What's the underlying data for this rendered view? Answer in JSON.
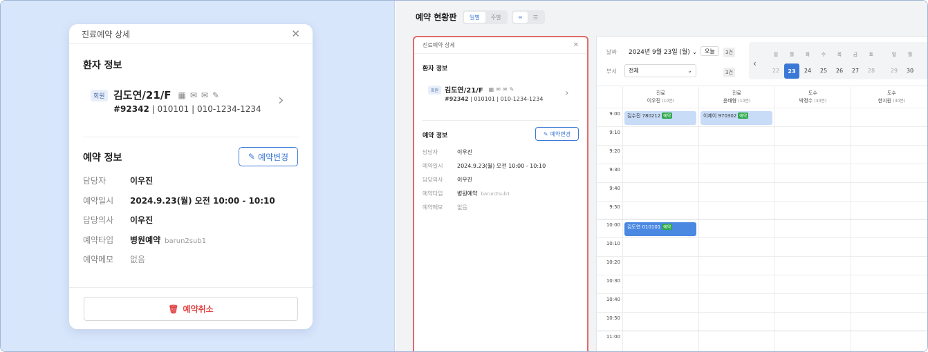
{
  "left_card": {
    "title": "진료예약 상세",
    "patient_section": "환자 정보",
    "badge": "회원",
    "patient_name": "김도연/21/F",
    "patient_id": "#92342",
    "patient_detail": "| 010101 | 010-1234-1234",
    "reservation_section": "예약 정보",
    "change_button": "예약변경",
    "rows": [
      {
        "k": "담당자",
        "v": "이우진"
      },
      {
        "k": "예약일시",
        "v": "2024.9.23(월)  오전 10:00 - 10:10"
      },
      {
        "k": "담당의사",
        "v": "이우진"
      },
      {
        "k": "예약타입",
        "v": "병원예약",
        "sub": "barun2sub1"
      },
      {
        "k": "예약메모",
        "v": "없음"
      }
    ],
    "cancel_button": "예약취소"
  },
  "right": {
    "title": "예약 현황판",
    "seg1": [
      "일별",
      "주별"
    ],
    "popup": {
      "title": "진료예약 상세",
      "patient_section": "환자 정보",
      "badge": "회원",
      "patient_name": "김도연/21/F",
      "patient_id": "#92342",
      "patient_detail": "| 010101 | 010-1234-1234",
      "reservation_section": "예약 정보",
      "change_button": "예약변경",
      "rows": [
        {
          "k": "담당자",
          "v": "이우진"
        },
        {
          "k": "예약일시",
          "v": "2024.9.23(월)  오전 10:00 - 10:10"
        },
        {
          "k": "담당의사",
          "v": "이우진"
        },
        {
          "k": "예약타입",
          "v": "병원예약",
          "sub": "barun2sub1"
        },
        {
          "k": "예약메모",
          "v": "없음"
        }
      ]
    },
    "filters": {
      "date_label": "날짜",
      "date_value": "2024년 9월 23일 (월)",
      "today": "오늘",
      "count1": "3건",
      "dept_label": "부서",
      "dept_value": "전체",
      "count2": "3건"
    },
    "mini_cal": {
      "weekdays": [
        "일",
        "월",
        "화",
        "수",
        "목",
        "금",
        "토",
        "일",
        "월"
      ],
      "days": [
        "22",
        "23",
        "24",
        "25",
        "26",
        "27",
        "28",
        "29",
        "30"
      ]
    },
    "columns": [
      {
        "dept": "진료",
        "name": "이우진",
        "dur": "(10분)"
      },
      {
        "dept": "진료",
        "name": "윤태형",
        "dur": "(10분)"
      },
      {
        "dept": "도수",
        "name": "박정수",
        "dur": "(30분)"
      },
      {
        "dept": "도수",
        "name": "한지원",
        "dur": "(30분)"
      }
    ],
    "times": [
      "9:00",
      "9:10",
      "9:20",
      "9:30",
      "9:40",
      "9:50",
      "10:00",
      "10:10",
      "10:20",
      "10:30",
      "10:40",
      "10:50",
      "11:00"
    ],
    "appointments": [
      {
        "text": "김수진 780212",
        "tag": "예약"
      },
      {
        "text": "이제이 970302",
        "tag": "예약"
      },
      {
        "text": "김도연 010101",
        "tag": "예약"
      }
    ]
  }
}
